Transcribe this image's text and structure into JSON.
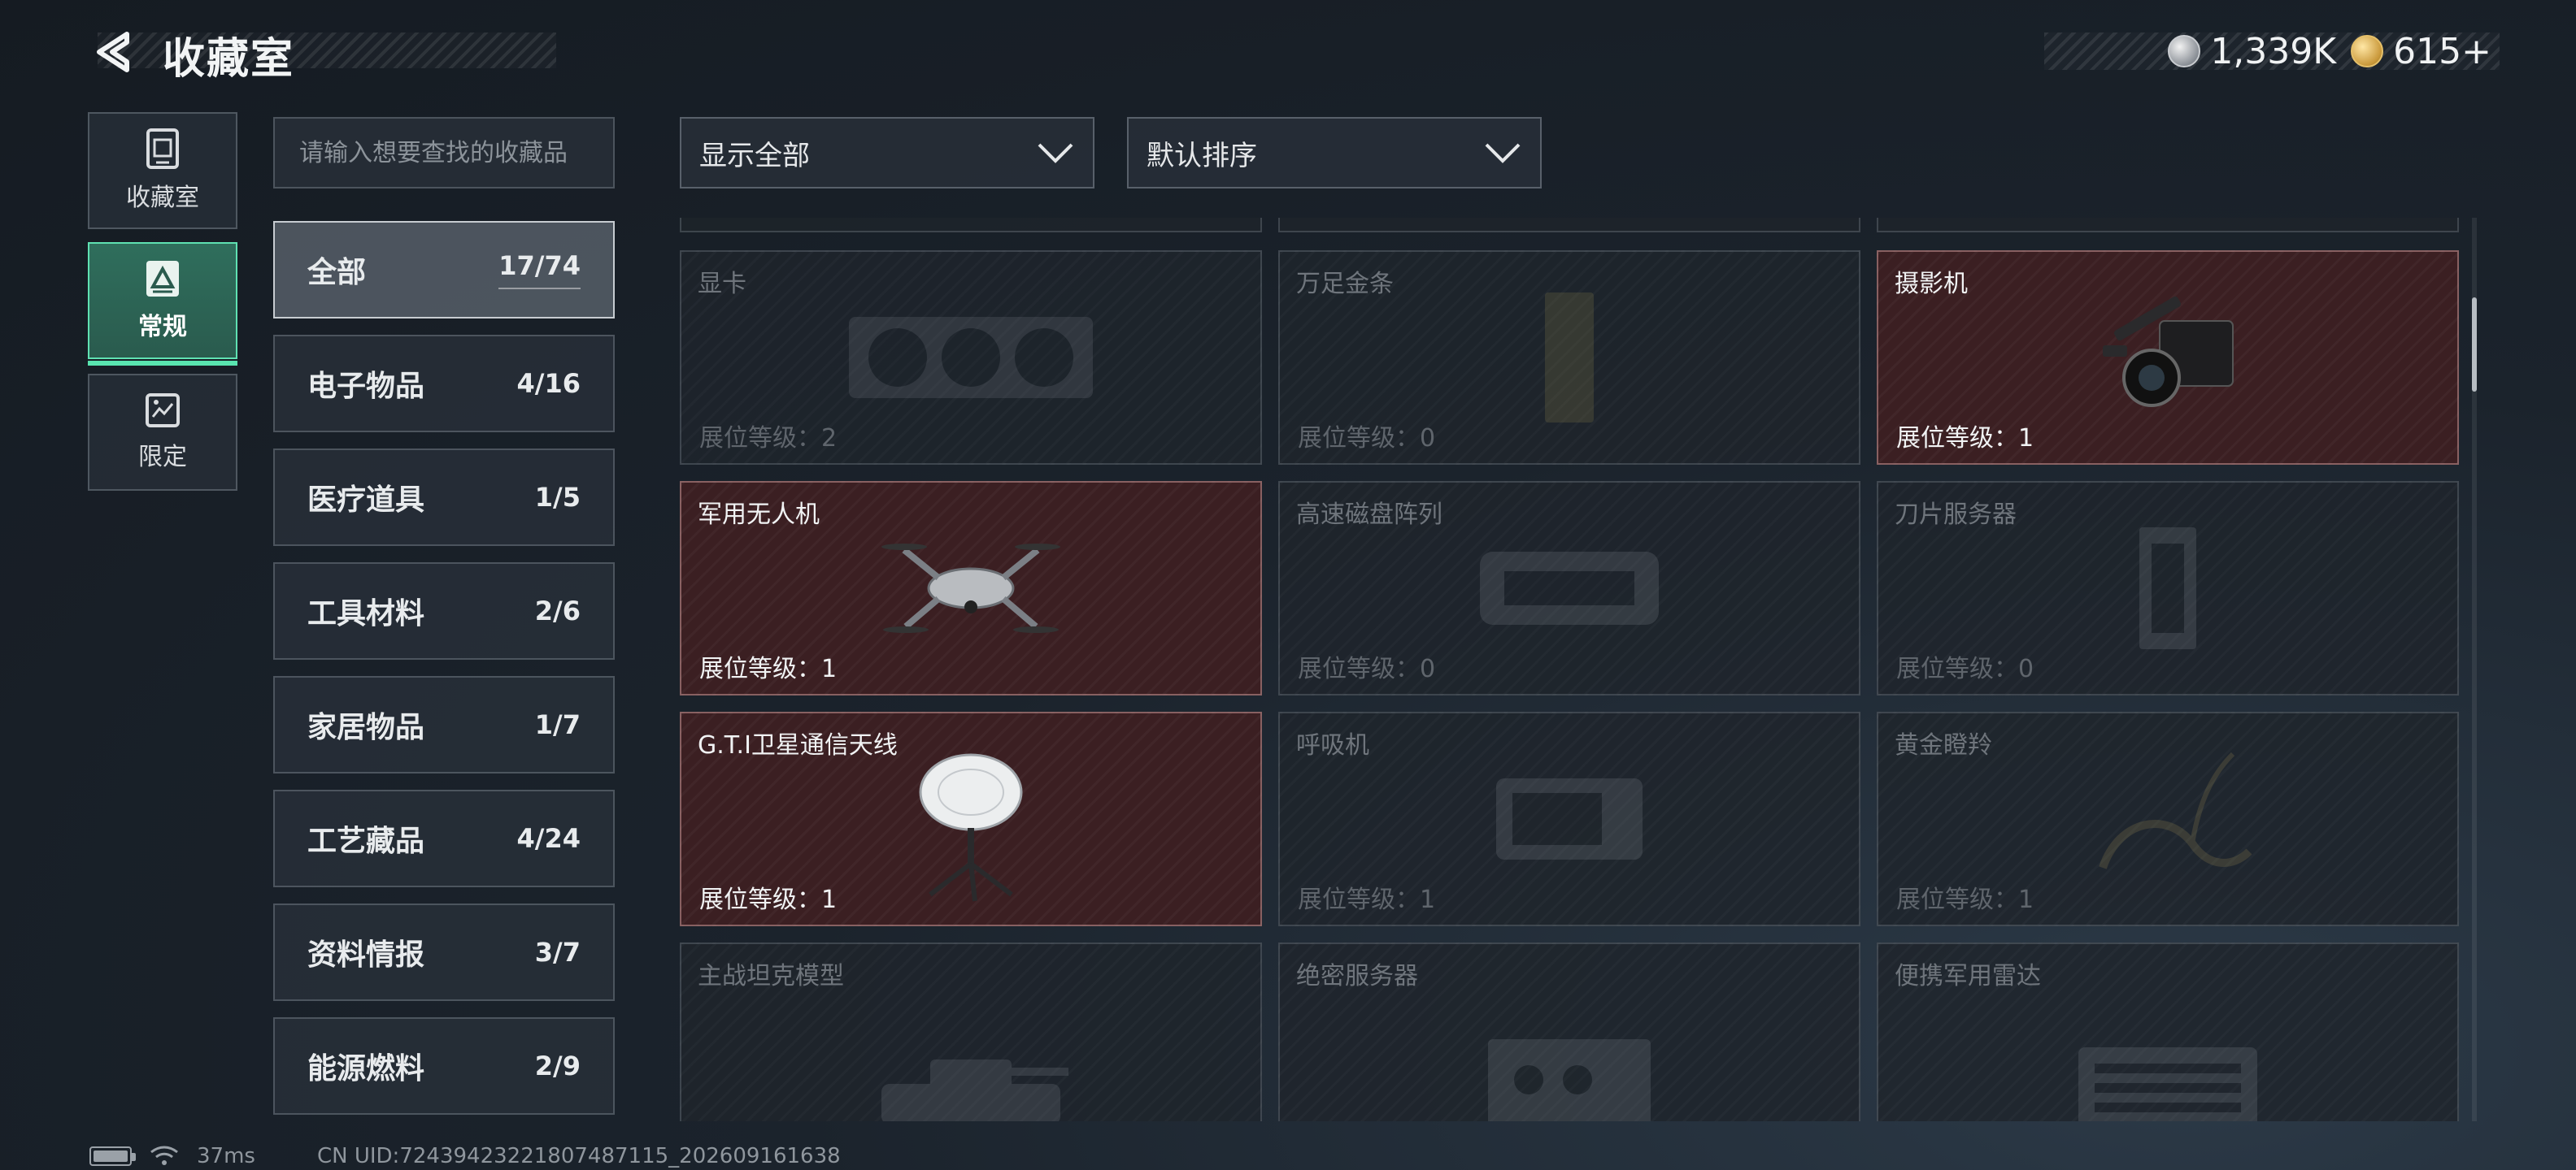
{
  "header": {
    "title": "收藏室",
    "currency": [
      {
        "icon": "silver-coin-icon",
        "value": "1,339K"
      },
      {
        "icon": "gold-coin-icon",
        "value": "615+"
      }
    ]
  },
  "nav": [
    {
      "label": "收藏室",
      "icon": "collection-room-icon",
      "active": false
    },
    {
      "label": "常规",
      "icon": "regular-icon",
      "active": true
    },
    {
      "label": "限定",
      "icon": "limited-icon",
      "active": false
    }
  ],
  "search": {
    "placeholder": "请输入想要查找的收藏品"
  },
  "categories": [
    {
      "name": "全部",
      "count": "17/74",
      "active": true
    },
    {
      "name": "电子物品",
      "count": "4/16"
    },
    {
      "name": "医疗道具",
      "count": "1/5"
    },
    {
      "name": "工具材料",
      "count": "2/6"
    },
    {
      "name": "家居物品",
      "count": "1/7"
    },
    {
      "name": "工艺藏品",
      "count": "4/24"
    },
    {
      "name": "资料情报",
      "count": "3/7"
    },
    {
      "name": "能源燃料",
      "count": "2/9"
    }
  ],
  "filters": {
    "display": "显示全部",
    "sort": "默认排序"
  },
  "level_label": "展位等级：",
  "items": [
    {
      "name": "显卡",
      "level": "2",
      "owned": false,
      "icon": "graphics-card-icon"
    },
    {
      "name": "万足金条",
      "level": "0",
      "owned": false,
      "icon": "gold-bar-icon"
    },
    {
      "name": "摄影机",
      "level": "1",
      "owned": true,
      "icon": "video-camera-icon"
    },
    {
      "name": "军用无人机",
      "level": "1",
      "owned": true,
      "icon": "drone-icon"
    },
    {
      "name": "高速磁盘阵列",
      "level": "0",
      "owned": false,
      "icon": "disk-array-icon"
    },
    {
      "name": "刀片服务器",
      "level": "0",
      "owned": false,
      "icon": "blade-server-icon"
    },
    {
      "name": "G.T.I卫星通信天线",
      "level": "1",
      "owned": true,
      "icon": "satellite-antenna-icon"
    },
    {
      "name": "呼吸机",
      "level": "1",
      "owned": false,
      "icon": "ventilator-icon"
    },
    {
      "name": "黄金瞪羚",
      "level": "1",
      "owned": false,
      "icon": "golden-gazelle-icon"
    },
    {
      "name": "主战坦克模型",
      "level": "",
      "owned": false,
      "icon": "tank-model-icon"
    },
    {
      "name": "绝密服务器",
      "level": "",
      "owned": false,
      "icon": "secret-server-icon"
    },
    {
      "name": "便携军用雷达",
      "level": "",
      "owned": false,
      "icon": "portable-radar-icon"
    }
  ],
  "footer": {
    "ping": "37ms",
    "uid": "CN UID:7243942322180748711​5_202609161638"
  }
}
